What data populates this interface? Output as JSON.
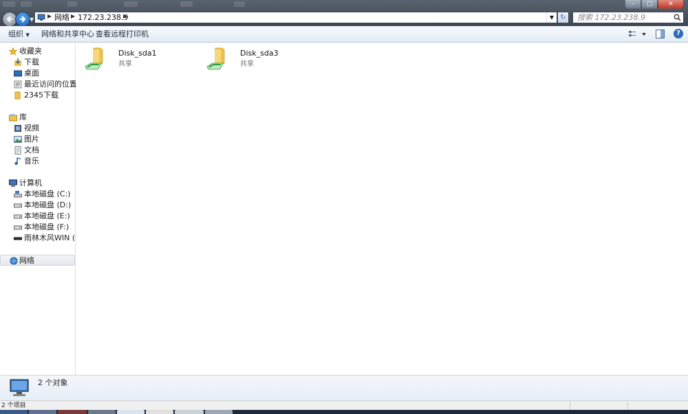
{
  "address": {
    "crumbs": [
      "网络",
      "172.23.238.9"
    ],
    "search_placeholder": "搜索 172.23.238.9"
  },
  "toolbar": {
    "organize": "组织",
    "network_center": "网络和共享中心",
    "remote_printers": "查看远程打印机"
  },
  "sidebar": {
    "favorites": {
      "title": "收藏夹",
      "items": [
        "下载",
        "桌面",
        "最近访问的位置",
        "2345下载"
      ]
    },
    "libraries": {
      "title": "库",
      "items": [
        "视频",
        "图片",
        "文档",
        "音乐"
      ]
    },
    "computer": {
      "title": "计算机",
      "items": [
        "本地磁盘 (C:)",
        "本地磁盘 (D:)",
        "本地磁盘 (E:)",
        "本地磁盘 (F:)",
        "雨林木风WIN (G:)"
      ]
    },
    "network": {
      "title": "网络"
    }
  },
  "folders": [
    {
      "name": "Disk_sda1",
      "subtitle": "共享"
    },
    {
      "name": "Disk_sda3",
      "subtitle": "共享"
    }
  ],
  "details": {
    "object_count": "2 个对象"
  },
  "status": {
    "item_count": "2 个项目"
  },
  "colors": {
    "titlebar": "#4c5664",
    "toolbar": "#e9eff6",
    "folder": "#f0c24a",
    "share_badge": "#2f9e3a",
    "accent": "#2c6bb8"
  }
}
